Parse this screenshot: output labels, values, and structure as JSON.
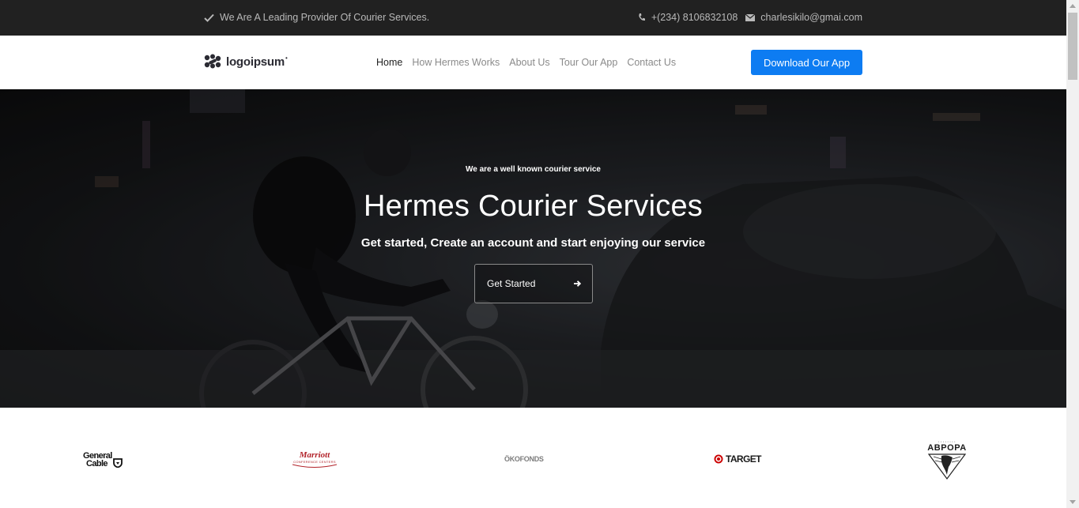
{
  "topbar": {
    "tagline": "We Are A Leading Provider Of Courier Services.",
    "phone": "+(234) 8106832108",
    "email": "charlesikilo@gmai.com"
  },
  "navbar": {
    "logo_text": "logoipsum",
    "links": [
      "Home",
      "How Hermes Works",
      "About Us",
      "Tour Our App",
      "Contact Us"
    ],
    "active_link": "Home",
    "cta": "Download Our App"
  },
  "hero": {
    "eyebrow": "We are a well known courier service",
    "title": "Hermes Courier Services",
    "subtitle": "Get started, Create an account and start enjoying our service",
    "button": "Get Started"
  },
  "brands": {
    "general_cable": [
      "General",
      "Cable"
    ],
    "marriott": "Marriott",
    "marriott_sub": "CONFERENCE CENTERS",
    "okofonds": "ÖKOFONDS",
    "target": "TARGET",
    "avrora": "АВРОРА"
  },
  "colors": {
    "topbar_bg": "#212121",
    "primary_button": "#0d7cf2",
    "hero_overlay": "#151618",
    "marriott_red": "#b2232a",
    "target_red": "#cc0000",
    "okofonds_yellow": "#e8c21c"
  }
}
